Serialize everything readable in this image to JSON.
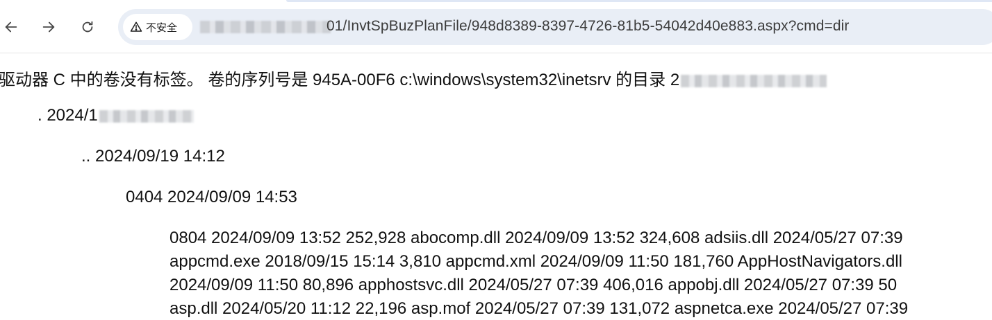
{
  "address_bar": {
    "security_label": "不安全",
    "url_visible": "01/InvtSpBuzPlanFile/948d8389-8397-4726-81b5-54042d40e883.aspx?cmd=dir"
  },
  "icons": {
    "back": "back-arrow-icon",
    "forward": "forward-arrow-icon",
    "reload": "reload-icon",
    "warning": "warning-triangle-icon"
  },
  "page": {
    "line1": "驱动器 C 中的卷没有标签。 卷的序列号是 945A-00F6 c:\\windows\\system32\\inetsrv 的目录 2",
    "line2": ". 2024/1",
    "line3": ".. 2024/09/19 14:12",
    "line4": "0404 2024/09/09 14:53",
    "block_lines": [
      "0804 2024/09/09 13:52 252,928 abocomp.dll 2024/09/09 13:52 324,608 adsiis.dll 2024/05/27 07:39",
      "appcmd.exe 2018/09/15 15:14 3,810 appcmd.xml 2024/09/09 11:50 181,760 AppHostNavigators.dll",
      "2024/09/09 11:50 80,896 apphostsvc.dll 2024/05/27 07:39 406,016 appobj.dll 2024/05/27 07:39 50",
      "asp.dll 2024/05/20 11:12 22,196 asp.mof 2024/05/27 07:39 131,072 aspnetca.exe 2024/05/27 07:39"
    ]
  },
  "colors": {
    "omnibox_bg": "#e9eef6",
    "toolbar_bg": "#ffffff",
    "text": "#111111"
  }
}
